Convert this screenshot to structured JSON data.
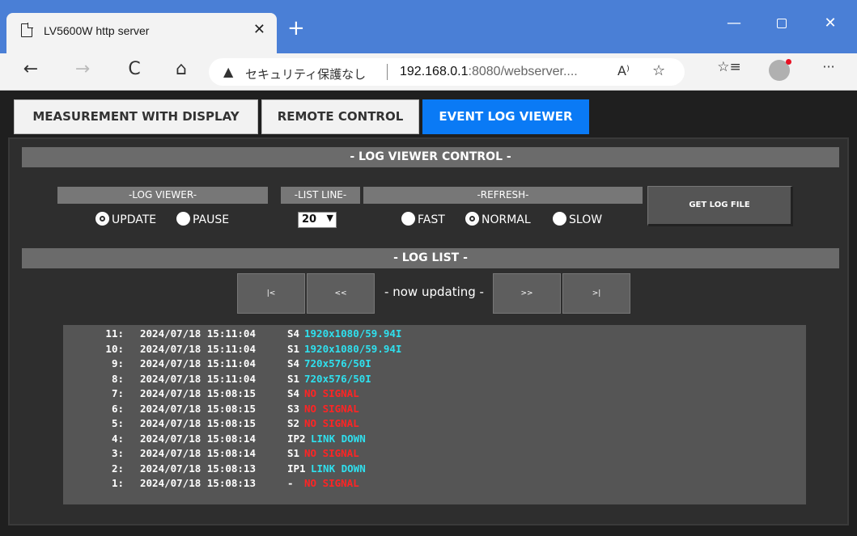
{
  "browser": {
    "tab_title": "LV5600W http server",
    "tab_close": "✕",
    "new_tab": "+",
    "window_min": "—",
    "window_close": "✕",
    "security_label": "セキュリティ保護なし",
    "url_host": "192.168.0.1",
    "url_rest": ":8080/webserver....",
    "read_aloud": "A⁾",
    "back": "←",
    "forward": "→",
    "reload": "C",
    "home": "⌂",
    "favorite": "☆",
    "favorites_bar": "☆≡",
    "more": "···"
  },
  "nav": {
    "measurement": "MEASUREMENT WITH DISPLAY",
    "remote": "REMOTE CONTROL",
    "event_log": "EVENT LOG VIEWER",
    "active": "event_log",
    "active_color": "#0a7af5"
  },
  "control": {
    "title": "- LOG VIEWER CONTROL -",
    "log_viewer_label": "-LOG VIEWER-",
    "update_label": "UPDATE",
    "pause_label": "PAUSE",
    "log_viewer_selected": "UPDATE",
    "list_line_label": "-LIST LINE-",
    "list_line_value": "20",
    "refresh_label": "-REFRESH-",
    "fast_label": "FAST",
    "normal_label": "NORMAL",
    "slow_label": "SLOW",
    "refresh_selected": "NORMAL",
    "get_log_file": "GET LOG FILE"
  },
  "loglist": {
    "title": "- LOG LIST -",
    "first": "|<",
    "prev": "<<",
    "status": "- now updating -",
    "next": ">>",
    "last": ">|",
    "colors": {
      "info": "#2fe0ee",
      "error": "#ff2424"
    },
    "rows": [
      {
        "num": "11:",
        "time": "2024/07/18 15:11:04",
        "src": "S4",
        "msg": "1920x1080/59.94I",
        "level": "info"
      },
      {
        "num": "10:",
        "time": "2024/07/18 15:11:04",
        "src": "S1",
        "msg": "1920x1080/59.94I",
        "level": "info"
      },
      {
        "num": "9:",
        "time": "2024/07/18 15:11:04",
        "src": "S4",
        "msg": "720x576/50I",
        "level": "info"
      },
      {
        "num": "8:",
        "time": "2024/07/18 15:11:04",
        "src": "S1",
        "msg": "720x576/50I",
        "level": "info"
      },
      {
        "num": "7:",
        "time": "2024/07/18 15:08:15",
        "src": "S4",
        "msg": "NO SIGNAL",
        "level": "error"
      },
      {
        "num": "6:",
        "time": "2024/07/18 15:08:15",
        "src": "S3",
        "msg": "NO SIGNAL",
        "level": "error"
      },
      {
        "num": "5:",
        "time": "2024/07/18 15:08:15",
        "src": "S2",
        "msg": "NO SIGNAL",
        "level": "error"
      },
      {
        "num": "4:",
        "time": "2024/07/18 15:08:14",
        "src": "IP2",
        "msg": "LINK DOWN",
        "level": "info"
      },
      {
        "num": "3:",
        "time": "2024/07/18 15:08:14",
        "src": "S1",
        "msg": "NO SIGNAL",
        "level": "error"
      },
      {
        "num": "2:",
        "time": "2024/07/18 15:08:13",
        "src": "IP1",
        "msg": "LINK DOWN",
        "level": "info"
      },
      {
        "num": "1:",
        "time": "2024/07/18 15:08:13",
        "src": "-",
        "msg": "NO SIGNAL",
        "level": "error"
      }
    ]
  }
}
